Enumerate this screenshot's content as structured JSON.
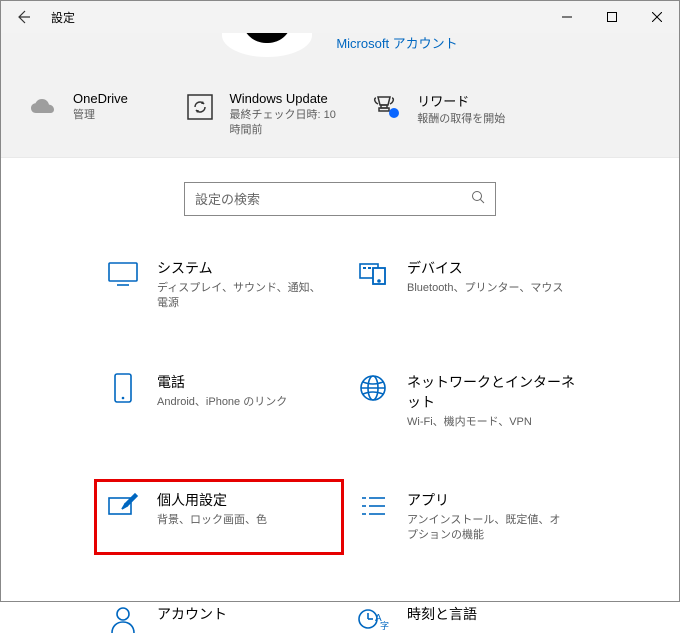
{
  "window": {
    "title": "設定",
    "account_link": "Microsoft アカウント"
  },
  "tiles": {
    "onedrive": {
      "title": "OneDrive",
      "sub": "管理"
    },
    "update": {
      "title": "Windows Update",
      "sub": "最終チェック日時: 10 時間前"
    },
    "rewards": {
      "title": "リワード",
      "sub": "報酬の取得を開始"
    }
  },
  "search": {
    "placeholder": "設定の検索"
  },
  "cats": {
    "system": {
      "title": "システム",
      "sub": "ディスプレイ、サウンド、通知、電源"
    },
    "devices": {
      "title": "デバイス",
      "sub": "Bluetooth、プリンター、マウス"
    },
    "phone": {
      "title": "電話",
      "sub": "Android、iPhone のリンク"
    },
    "network": {
      "title": "ネットワークとインターネット",
      "sub": "Wi-Fi、機内モード、VPN"
    },
    "personal": {
      "title": "個人用設定",
      "sub": "背景、ロック画面、色"
    },
    "apps": {
      "title": "アプリ",
      "sub": "アンインストール、既定値、オプションの機能"
    },
    "accounts": {
      "title": "アカウント"
    },
    "time": {
      "title": "時刻と言語"
    }
  },
  "highlighted_category": "personal"
}
